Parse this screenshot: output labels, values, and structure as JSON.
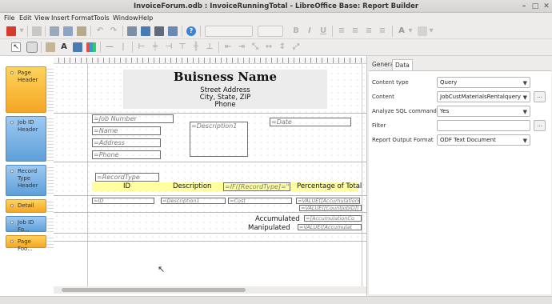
{
  "window": {
    "title": "InvoiceForum.odb : InvoiceRunningTotal - LibreOffice Base: Report Builder",
    "close": "✕"
  },
  "menu": [
    "File",
    "Edit",
    "View",
    "Insert",
    "Format",
    "Tools",
    "Window",
    "Help"
  ],
  "toolbar": {
    "font_name": "",
    "font_size": "",
    "bold": "B",
    "italic": "I",
    "underline": "U",
    "font_color": "A"
  },
  "sections": [
    {
      "label": "Page Header",
      "color": "orange"
    },
    {
      "label": "Job ID Header",
      "color": "blue"
    },
    {
      "label": "Record Type Header",
      "color": "blue"
    },
    {
      "label": "Detail",
      "color": "orange"
    },
    {
      "label": "Job ID Fo...",
      "color": "blue"
    },
    {
      "label": "Page Foo...",
      "color": "orange"
    }
  ],
  "page_header": {
    "business_name": "Buisness Name",
    "street": "Street Address",
    "city": "City, State, ZIP",
    "phone": "Phone"
  },
  "job_header": {
    "job_number": "=Job Number",
    "name": "=Name",
    "address": "=Address",
    "phone": "=Phone",
    "description": "=Description1",
    "date": "=Date"
  },
  "record_header": {
    "record_type": "=RecordType",
    "col_id": "ID",
    "col_description": "Description",
    "col_if": "=IF([RecordType]=\"Re",
    "col_percentage": "Percentage of Total"
  },
  "detail": {
    "id": "=ID",
    "description": "=Description1",
    "cost": "=Cost",
    "value1": "=VALUE([AccumulationCo",
    "value2": "=VALUE([CountJobID])"
  },
  "job_footer": {
    "accumulated": "Accumulated",
    "manipulated": "Manipulated",
    "accum_field": "=[AccumulationCo",
    "value_field": "=VALUE([Accumulat"
  },
  "props": {
    "tabs": [
      "General",
      "Data"
    ],
    "active_tab": "Data",
    "rows": [
      {
        "label": "Content type",
        "value": "Query",
        "dropdown": true,
        "more": false
      },
      {
        "label": "Content",
        "value": "JobCustMaterialsRentalquery",
        "dropdown": true,
        "more": true
      },
      {
        "label": "Analyze SQL command",
        "value": "Yes",
        "dropdown": true,
        "more": false
      },
      {
        "label": "Filter",
        "value": "",
        "dropdown": false,
        "more": true
      },
      {
        "label": "Report Output Format",
        "value": "ODF Text Document",
        "dropdown": true,
        "more": false
      }
    ]
  },
  "colors": {
    "orange_section": "#f5a623",
    "blue_section": "#5e9fd8",
    "highlight_row": "#ffffa0"
  }
}
